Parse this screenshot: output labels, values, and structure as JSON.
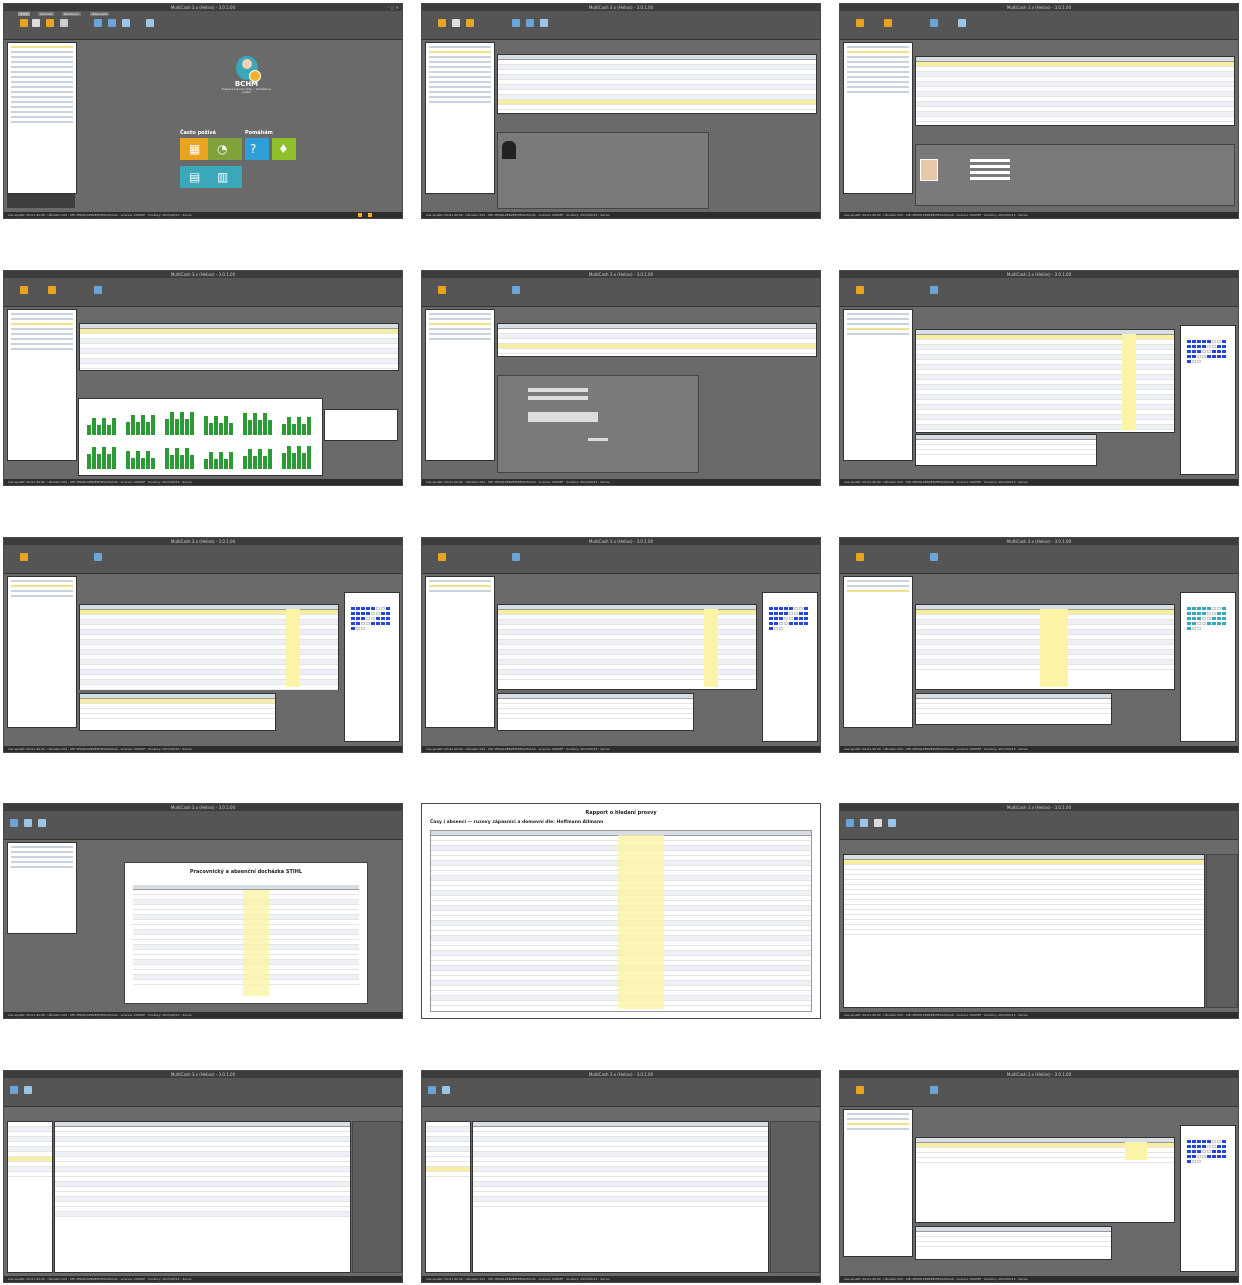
{
  "app": {
    "window_title": "MultiCash 3.x (Helios) - 3.0.1.00",
    "status_text": "Cas spustit: 00.01.40.00 · Uživatel: 001 · DB: MSSQLSERVER\\HELIOS\\CAS · Licence: 00005F · Soubory: 2013/04/15 · Servis"
  },
  "ribbon_tabs": [
    "Úvod",
    "Zobrazit",
    "Nastavení",
    "Nápověda"
  ],
  "home": {
    "logo": "BCHM",
    "logo_sub": "Evidence pracovní doby — Docházkový systém",
    "group_quick": "Často požívá",
    "group_help": "Pomáhám"
  },
  "report": {
    "title": "Rapport o hledaní prosvy",
    "subtitle": "Časy i absencí — ruzovy zápasníci a domovní dle: Hoffmann Allmann"
  },
  "report_preview": {
    "title": "Pracovnický a absenční docházka STIHL"
  },
  "colors": {
    "window_bg": "#6a6a6a",
    "title_bar": "#3c3c3c",
    "selection": "#f7eea0",
    "tile_orange": "#e8a41e",
    "tile_teal": "#3aa8b8",
    "tile_lime": "#8fbf2a",
    "calendar_blue": "#2546d6",
    "calendar_green": "#2c9a35"
  }
}
